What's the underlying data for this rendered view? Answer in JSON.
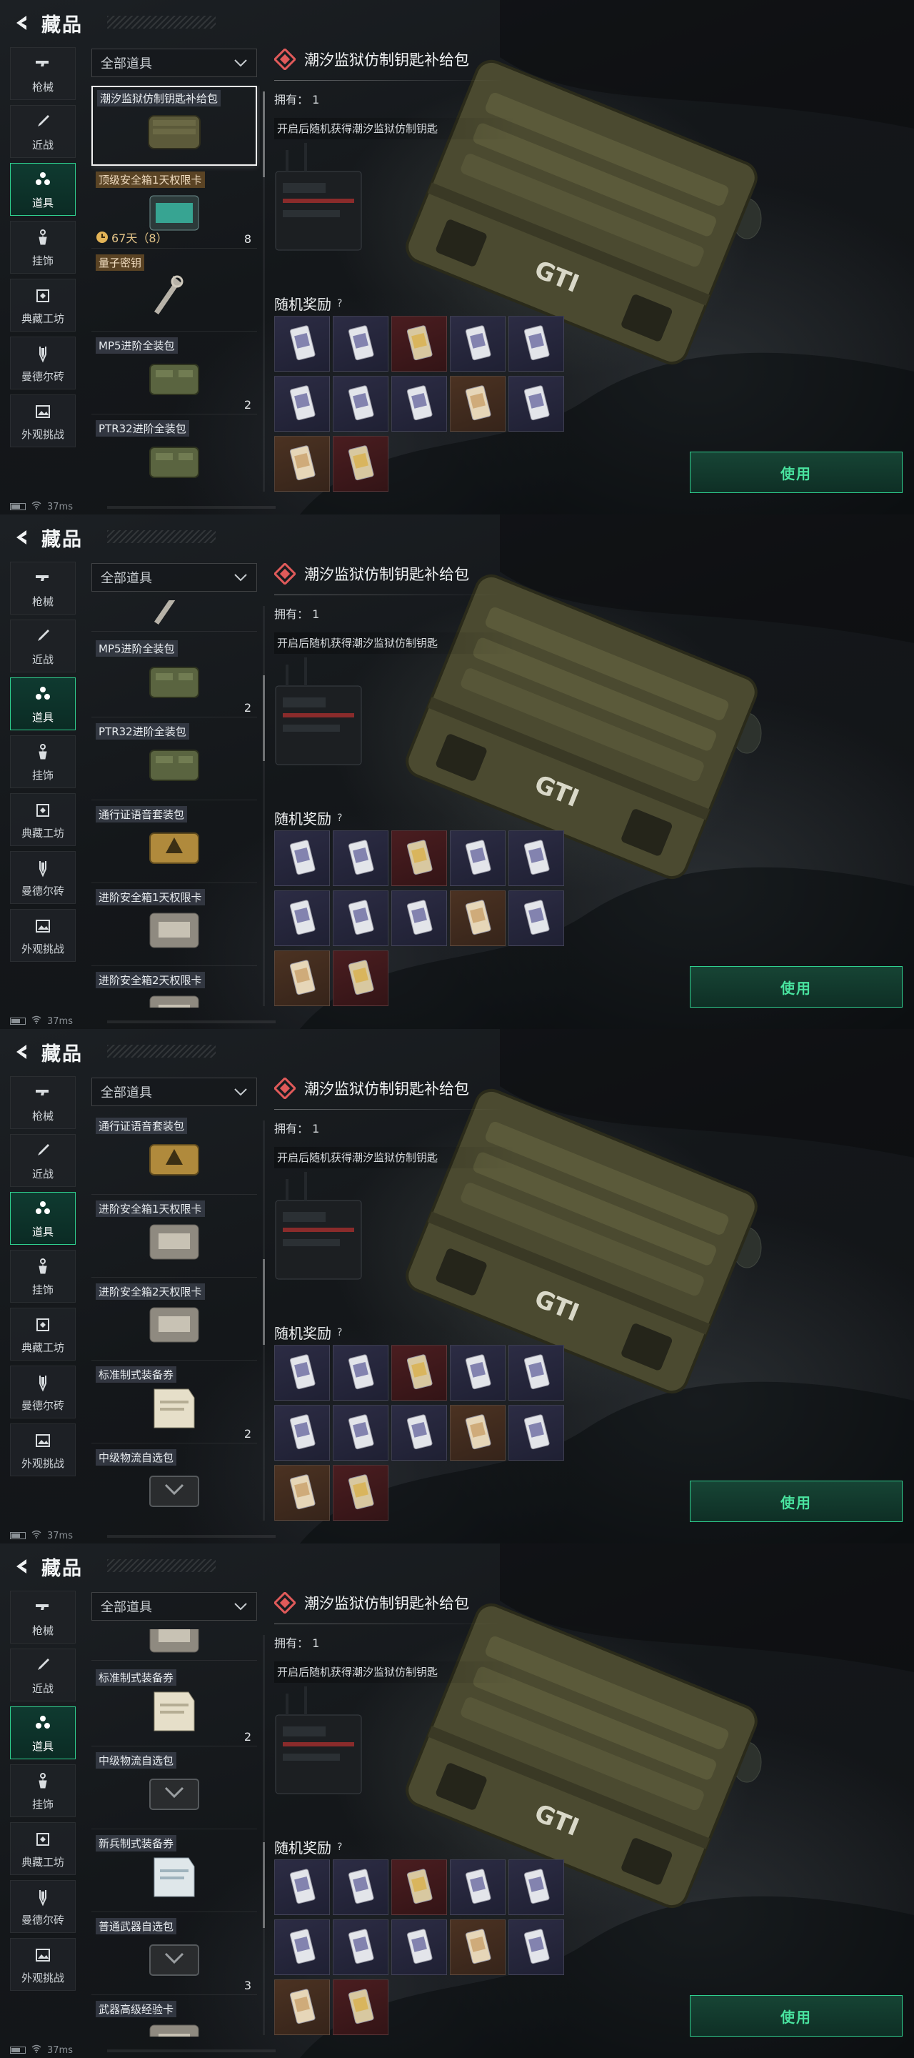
{
  "header": {
    "title": "藏品"
  },
  "sidebar": {
    "items": [
      {
        "label": "枪械",
        "icon": "gun-icon"
      },
      {
        "label": "近战",
        "icon": "knife-icon"
      },
      {
        "label": "道具",
        "icon": "items-icon"
      },
      {
        "label": "挂饰",
        "icon": "charm-icon"
      },
      {
        "label": "典藏工坊",
        "icon": "workshop-icon"
      },
      {
        "label": "曼德尔砖",
        "icon": "brick-icon"
      },
      {
        "label": "外观挑战",
        "icon": "image-icon"
      }
    ],
    "active_index": 2
  },
  "filter": {
    "selected": "全部道具"
  },
  "status": {
    "ping": "37ms"
  },
  "detail": {
    "title": "潮汐监狱仿制钥匙补给包",
    "owned_label": "拥有：",
    "owned_value": "1",
    "description": "开启后随机获得潮汐监狱仿制钥匙",
    "random_rewards_label": "随机奖励",
    "help_mark": "?",
    "use_button": "使用"
  },
  "reward_cells": [
    "blue",
    "blue",
    "red",
    "blue",
    "blue",
    "blue",
    "blue",
    "blue",
    "orange",
    "blue",
    "orange",
    "red"
  ],
  "screens": [
    {
      "scroll_fraction": 0.0,
      "items": [
        {
          "name": "潮汐监狱仿制钥匙补给包",
          "thumb": "supply-case",
          "selected": true
        },
        {
          "name": "顶级安全箱1天权限卡",
          "thumb": "card-teal",
          "gold": true,
          "timer": "67天（8）",
          "count": "8"
        },
        {
          "name": "量子密钥",
          "thumb": "key",
          "gold": true
        },
        {
          "name": "MP5进阶全装包",
          "thumb": "green-bag",
          "count": "2"
        },
        {
          "name": "PTR32进阶全装包",
          "thumb": "green-bag"
        }
      ]
    },
    {
      "scroll_fraction": 0.22,
      "items": [
        {
          "name": "",
          "thumb": "key",
          "partial": true
        },
        {
          "name": "MP5进阶全装包",
          "thumb": "green-bag",
          "count": "2"
        },
        {
          "name": "PTR32进阶全装包",
          "thumb": "green-bag"
        },
        {
          "name": "通行证语音套装包",
          "thumb": "yellow-bag"
        },
        {
          "name": "进阶安全箱1天权限卡",
          "thumb": "card-grey"
        },
        {
          "name": "进阶安全箱2天权限卡",
          "thumb": "card-grey"
        }
      ]
    },
    {
      "scroll_fraction": 0.44,
      "items": [
        {
          "name": "通行证语音套装包",
          "thumb": "yellow-bag"
        },
        {
          "name": "进阶安全箱1天权限卡",
          "thumb": "card-grey"
        },
        {
          "name": "进阶安全箱2天权限卡",
          "thumb": "card-grey"
        },
        {
          "name": "标准制式装备券",
          "thumb": "paper",
          "count": "2"
        },
        {
          "name": "中级物流自选包",
          "thumb": "dark-box"
        }
      ]
    },
    {
      "scroll_fraction": 0.66,
      "items": [
        {
          "name": "",
          "thumb": "card-grey",
          "partial": true
        },
        {
          "name": "标准制式装备券",
          "thumb": "paper",
          "count": "2"
        },
        {
          "name": "中级物流自选包",
          "thumb": "dark-box"
        },
        {
          "name": "新兵制式装备券",
          "thumb": "paper-blue"
        },
        {
          "name": "普通武器自选包",
          "thumb": "dark-box",
          "count": "3"
        },
        {
          "name": "武器高级经验卡",
          "thumb": "card-grey"
        }
      ]
    }
  ]
}
